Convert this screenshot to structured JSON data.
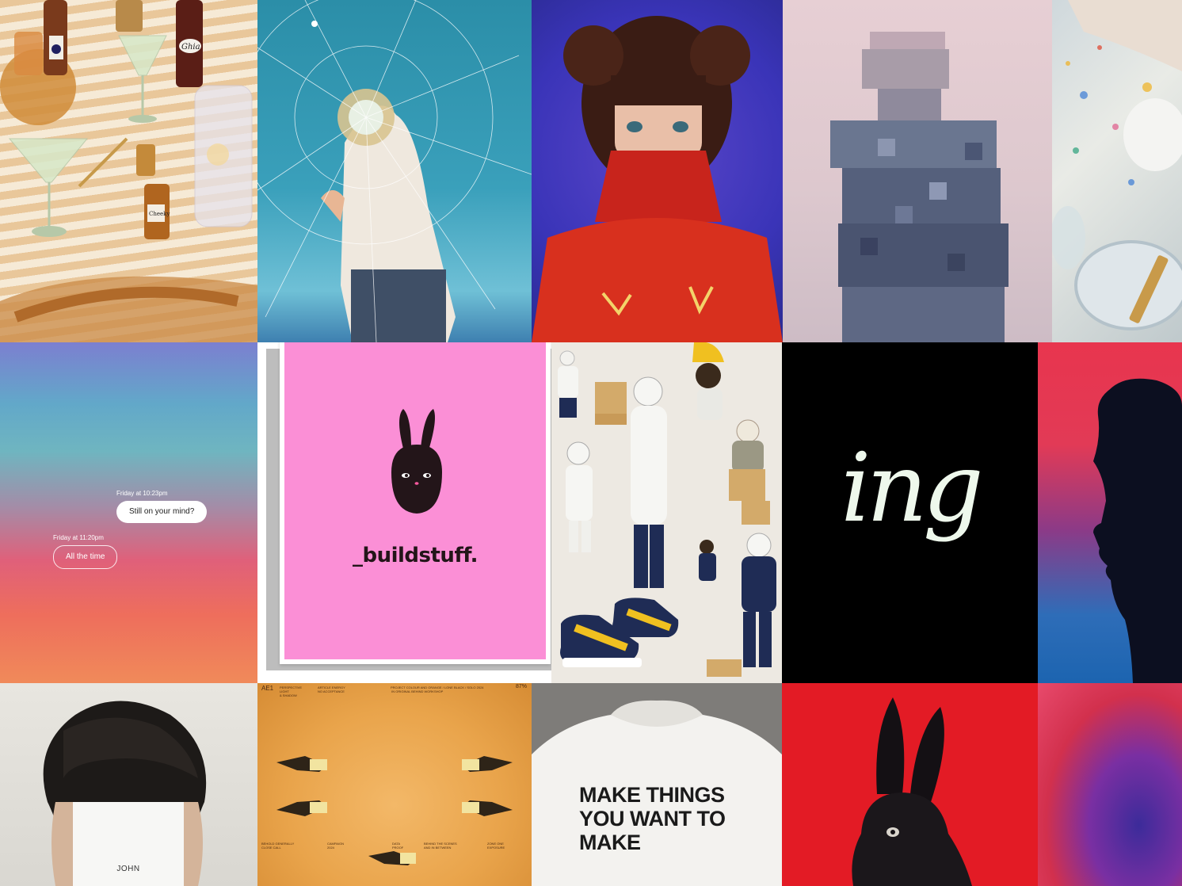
{
  "board": {
    "tiles": [
      {
        "id": "cocktail-table"
      },
      {
        "id": "broken-glass"
      },
      {
        "id": "red-turtleneck"
      },
      {
        "id": "pixelated-figure"
      },
      {
        "id": "paint-floor"
      },
      {
        "id": "chat-gradient"
      },
      {
        "id": "buildstuff-card"
      },
      {
        "id": "beekeepers"
      },
      {
        "id": "ing-wordmark"
      },
      {
        "id": "silhouette-profile"
      },
      {
        "id": "john-portrait"
      },
      {
        "id": "yellow-poster"
      },
      {
        "id": "slogan-sweatshirt"
      },
      {
        "id": "black-rabbit"
      },
      {
        "id": "blur-gradient"
      }
    ]
  },
  "chat": {
    "meta_1": "Friday at 10:23pm",
    "bubble_1": "Still on your mind?",
    "meta_2": "Friday at 11:20pm",
    "bubble_2": "All the time"
  },
  "buildstuff": {
    "wordmark": "_buildstuff.",
    "pink": "#fb8fd6"
  },
  "ing": {
    "wordmark": "ing"
  },
  "bottles": {
    "label_1": "Ghia",
    "label_2": "Cheeky"
  },
  "john": {
    "name": "JOHN"
  },
  "poster": {
    "mark": "AE1",
    "corner": "87%",
    "text_1": "PERSPECTIVE\nLIGHT\n& SHADOW",
    "text_2": "ARTICLE ENERGY\nNO ACCEPTANCE",
    "text_3": "PROJECT COLOUR AND ORANGE / LONE BLACK / SOLO 2024\n IN ORIGINAL BEHIND WORKSHOP",
    "text_4": "BEHOLD GENERALLY\nCLOSE CALL",
    "text_5": "CAMPAIGN\n2024",
    "text_6": "DATA\nPROOF",
    "text_7": "BEHIND THE SCENES\nAND IN BETWEEN",
    "text_8": "ZONE ONE\nEXPOSURE"
  },
  "shirt": {
    "line_1": "MAKE THINGS",
    "line_2": "YOU WANT TO",
    "line_3": "MAKE"
  }
}
